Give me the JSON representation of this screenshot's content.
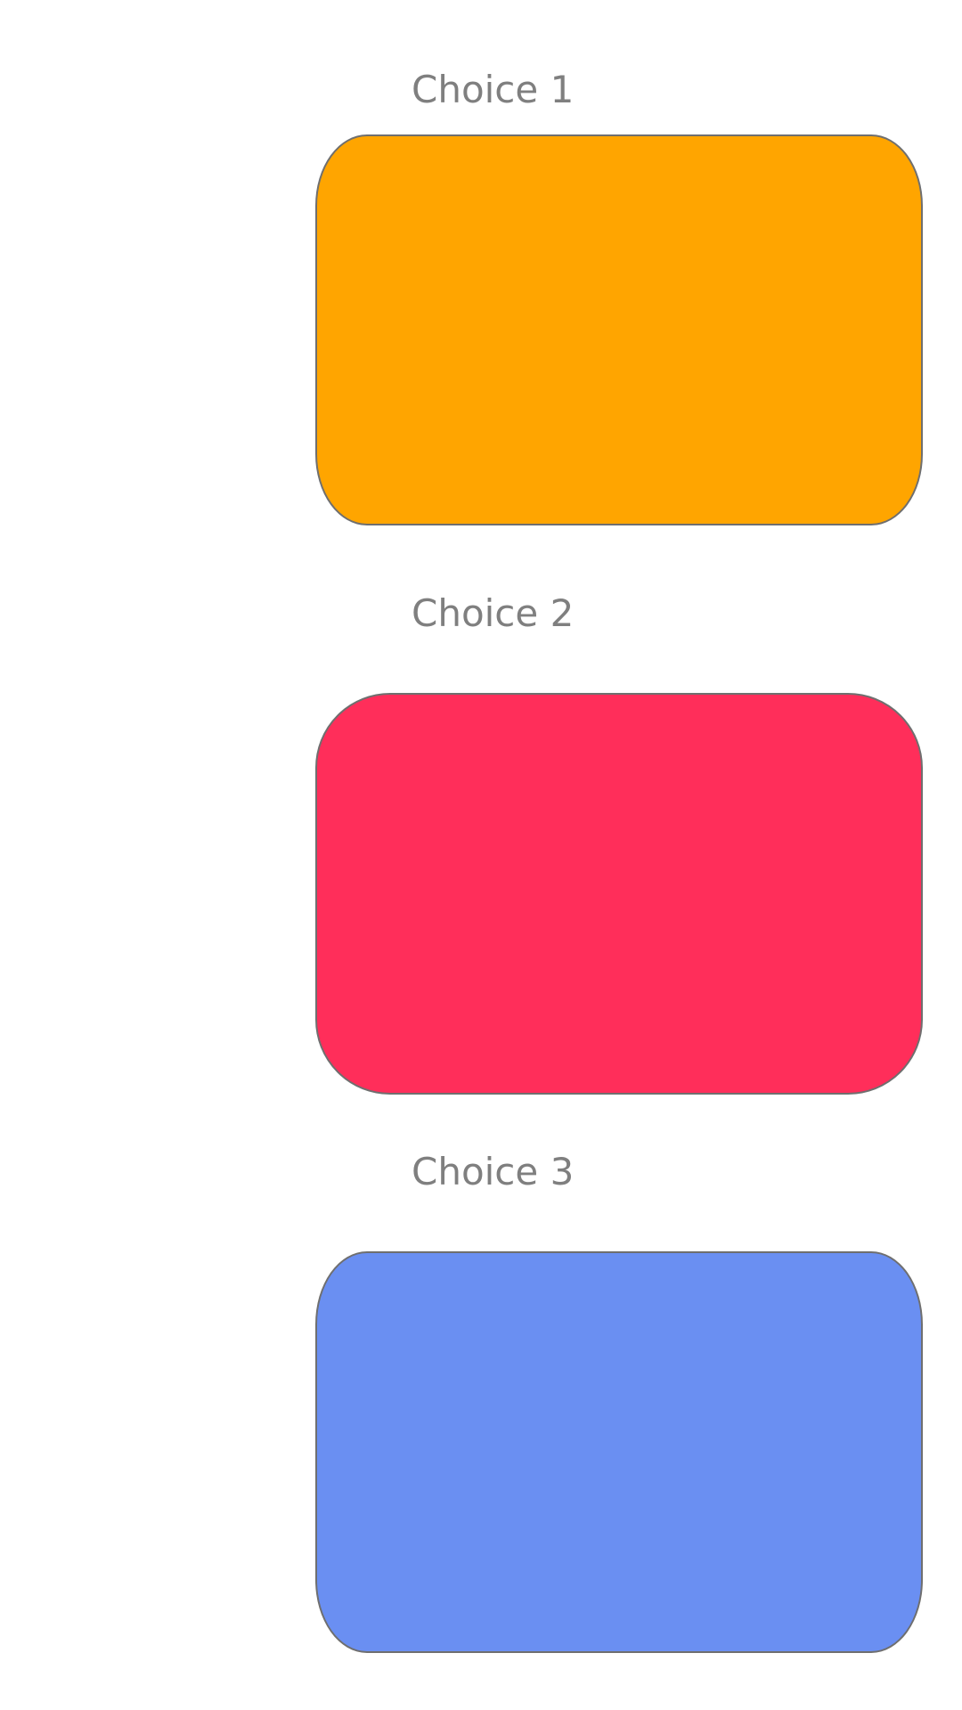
{
  "choices": [
    {
      "label": "Choice 1",
      "color": "#FFA500"
    },
    {
      "label": "Choice 2",
      "color": "#FF2E5A"
    },
    {
      "label": "Choice 3",
      "color": "#6A8FF2"
    }
  ],
  "colors": {
    "label_text": "#7F7F7F",
    "card_border": "#6F6F6F",
    "background": "#FFFFFF"
  }
}
